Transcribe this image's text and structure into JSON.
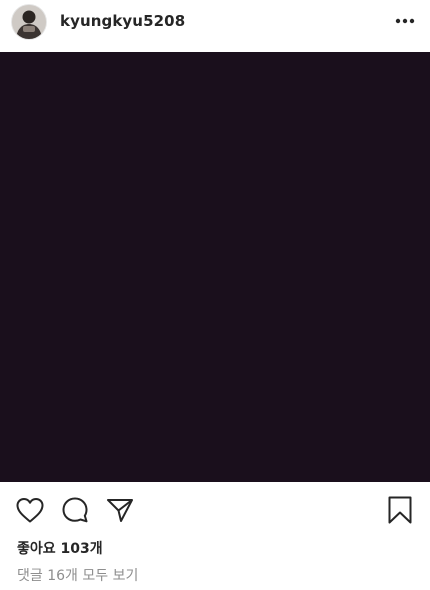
{
  "post": {
    "username": "kyungkyu5208",
    "likes_text": "좋아요 103개",
    "view_comments_text": "댓글 16개 모두 보기"
  },
  "icons": {
    "avatar": "profile-photo",
    "more": "more-options-icon",
    "like": "heart-icon",
    "comment": "comment-bubble-icon",
    "share": "send-paper-plane-icon",
    "save": "bookmark-icon"
  },
  "colors": {
    "photo_background": "#1a0f1c",
    "text_primary": "#262626",
    "text_secondary": "#8e8e8e"
  }
}
